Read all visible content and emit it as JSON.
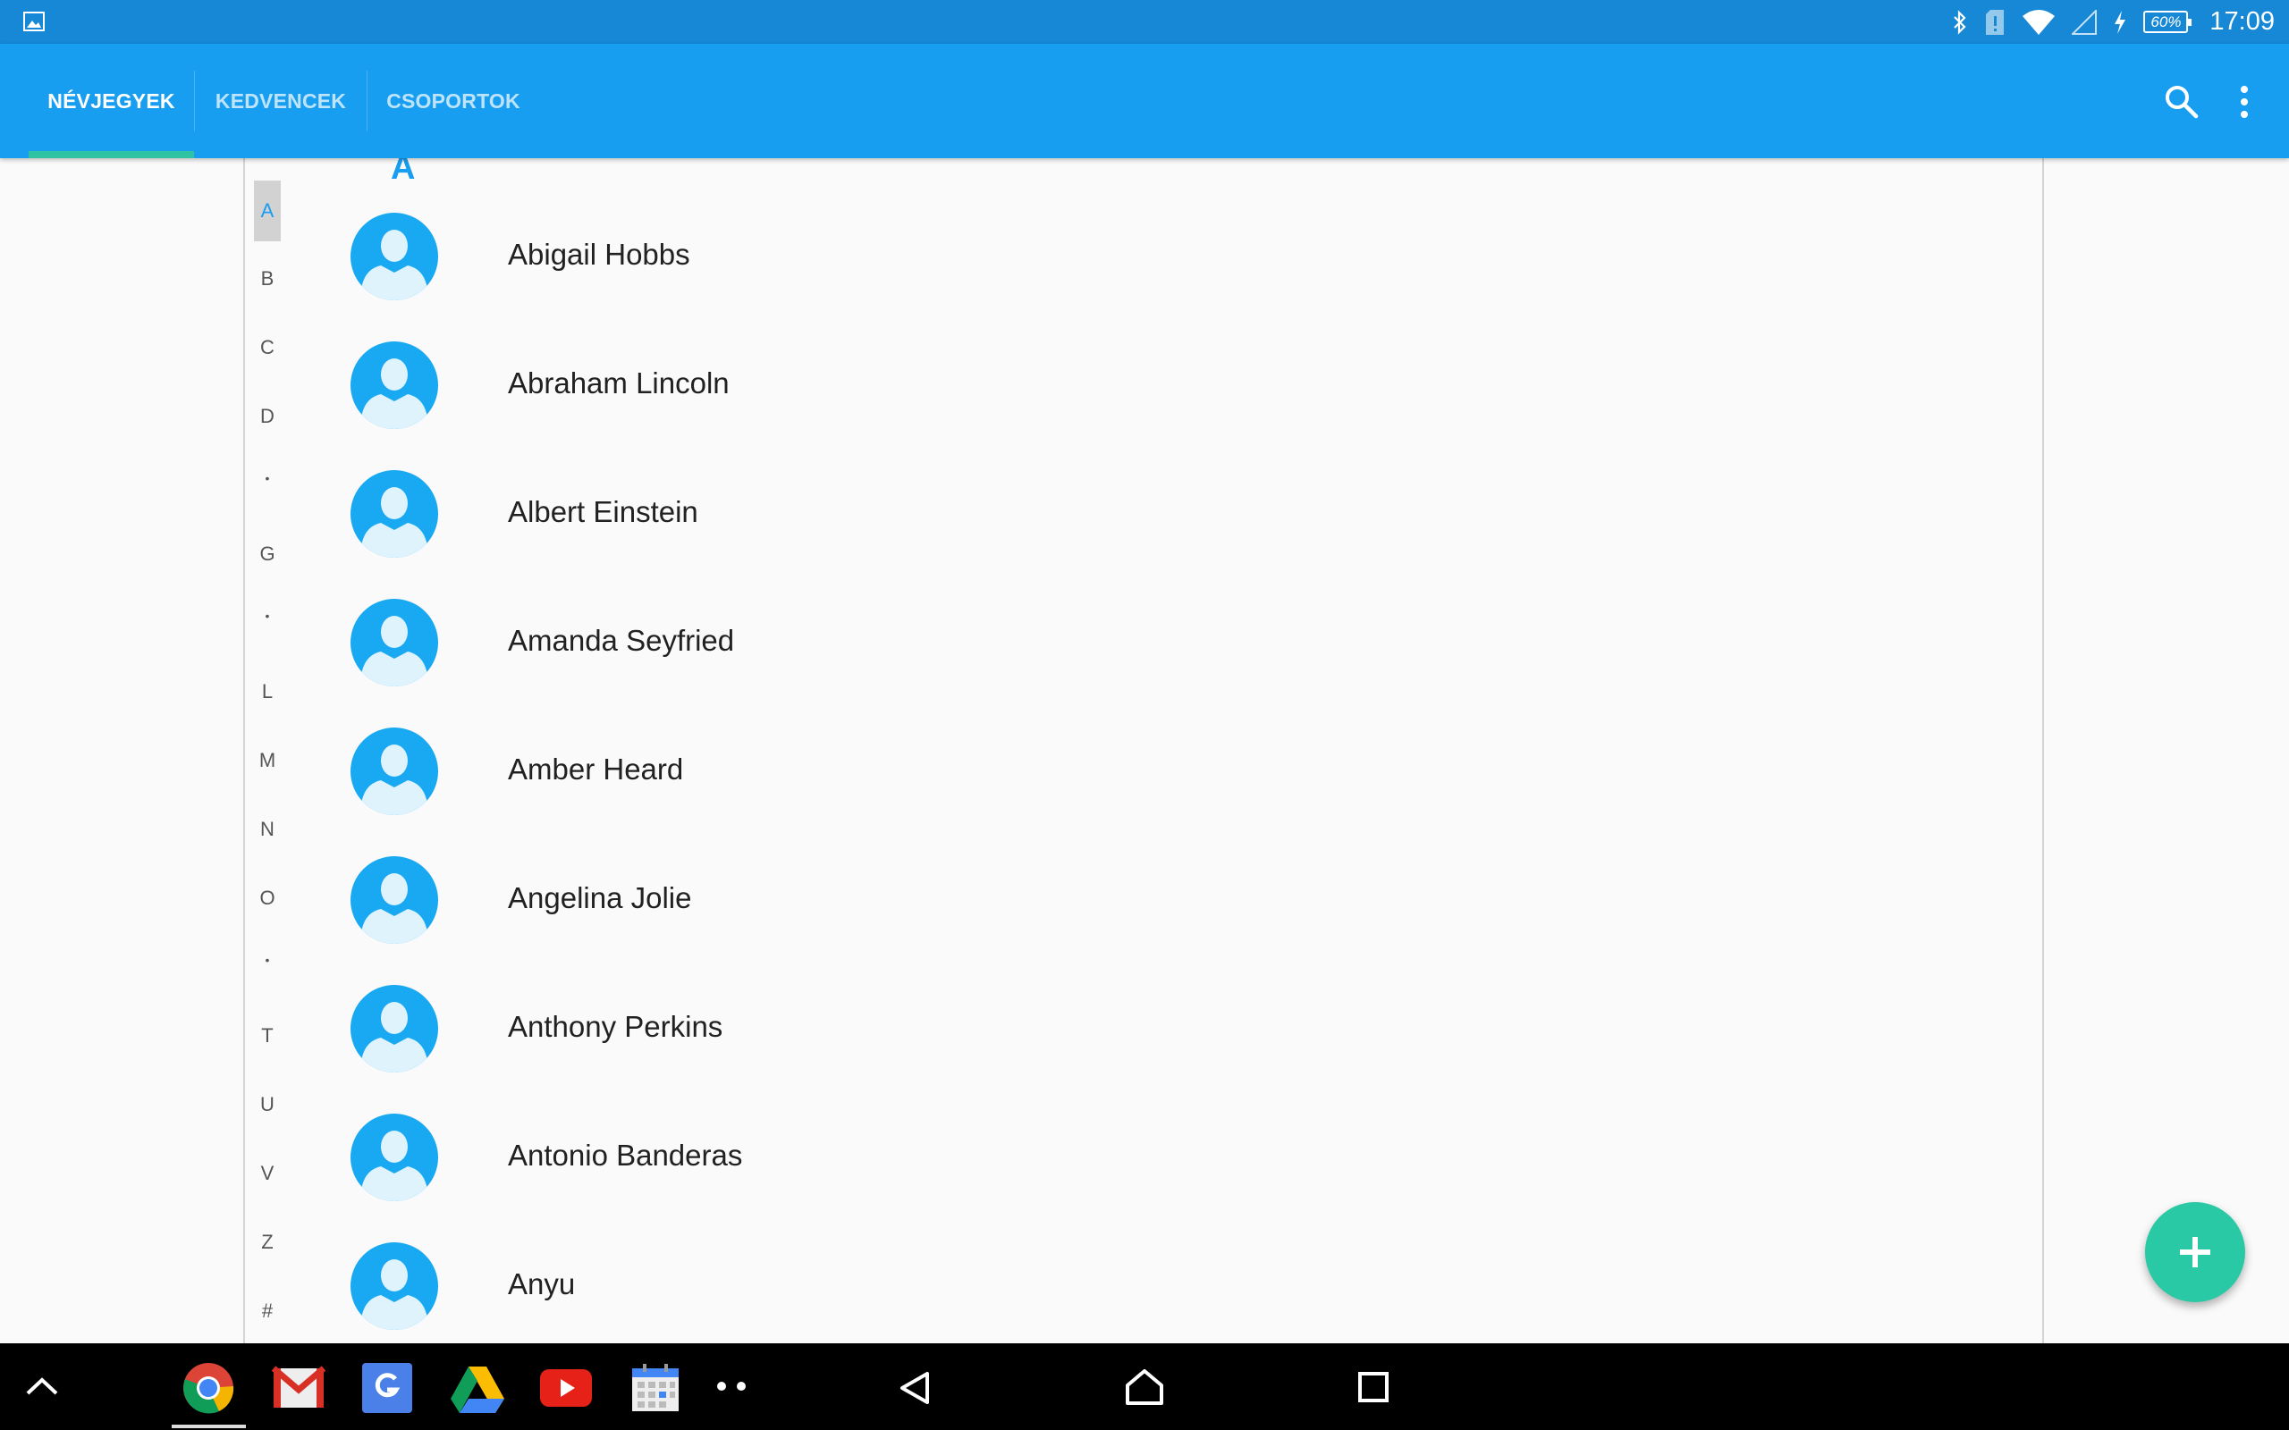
{
  "status_bar": {
    "time": "17:09",
    "battery": "60%",
    "icons": [
      "gallery-icon",
      "bluetooth-icon",
      "sd-card-alert-icon",
      "wifi-icon",
      "signal-icon",
      "charging-icon",
      "battery-icon"
    ]
  },
  "tabs": [
    {
      "label": "NÉVJEGYEK",
      "active": true
    },
    {
      "label": "KEDVENCEK",
      "active": false
    },
    {
      "label": "CSOPORTOK",
      "active": false
    }
  ],
  "toolbar": {
    "icons": [
      "search-icon",
      "more-vert-icon"
    ]
  },
  "section_header": "A",
  "index_letters": [
    "A",
    "B",
    "C",
    "D",
    "•",
    "G",
    "•",
    "L",
    "M",
    "N",
    "O",
    "•",
    "T",
    "U",
    "V",
    "Z",
    "#"
  ],
  "contacts": [
    {
      "name": "Abigail Hobbs"
    },
    {
      "name": "Abraham Lincoln"
    },
    {
      "name": "Albert Einstein"
    },
    {
      "name": "Amanda Seyfried"
    },
    {
      "name": "Amber Heard"
    },
    {
      "name": "Angelina Jolie"
    },
    {
      "name": "Anthony Perkins"
    },
    {
      "name": "Antonio Banderas"
    },
    {
      "name": "Anyu"
    }
  ],
  "fab": {
    "icon": "add-icon"
  },
  "nav_bar": {
    "apps": [
      "chrome-icon",
      "gmail-icon",
      "google-icon",
      "drive-icon",
      "youtube-icon",
      "calendar-icon"
    ],
    "buttons": [
      "back-icon",
      "home-icon",
      "recents-icon"
    ]
  },
  "colors": {
    "primary": "#189ef0",
    "status_bar": "#1688d6",
    "accent": "#29c9a5",
    "avatar": "#19a8f2"
  }
}
